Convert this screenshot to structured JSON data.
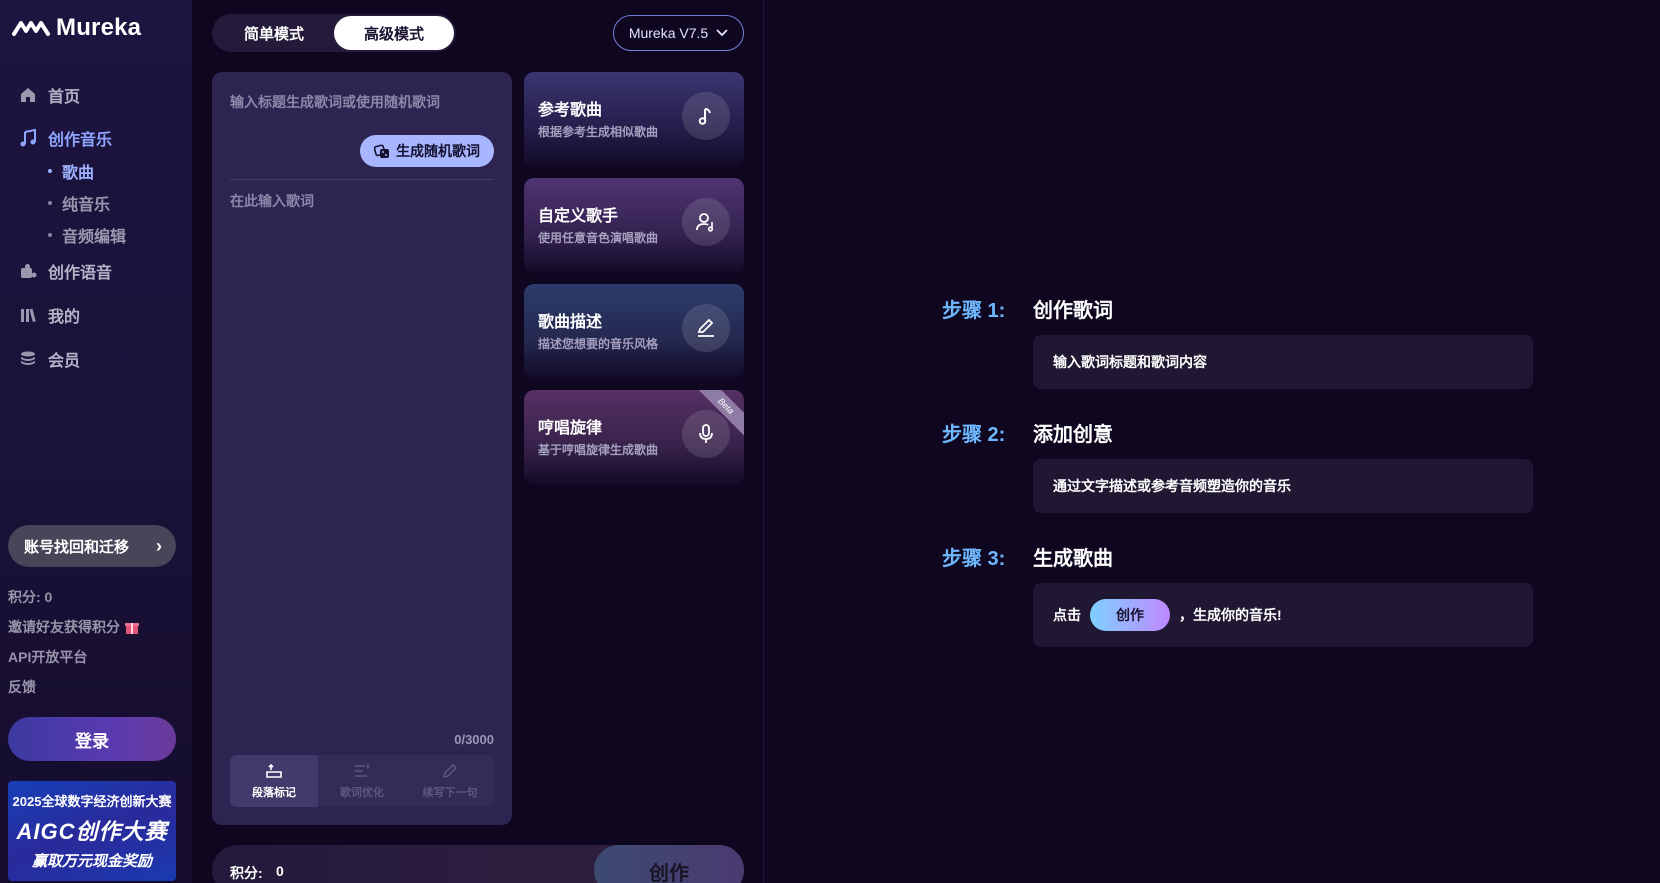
{
  "app": {
    "name": "Mureka"
  },
  "sidebar": {
    "nav": [
      {
        "label": "首页",
        "icon": "home-icon"
      },
      {
        "label": "创作音乐",
        "icon": "music-note-icon"
      },
      {
        "label": "创作语音",
        "icon": "voice-icon"
      },
      {
        "label": "我的",
        "icon": "library-icon"
      },
      {
        "label": "会员",
        "icon": "coins-icon"
      }
    ],
    "sub_items": [
      "歌曲",
      "纯音乐",
      "音频编辑"
    ],
    "account_button": "账号找回和迁移",
    "points": "积分: 0",
    "invite": "邀请好友获得积分",
    "api": "API开放平台",
    "feedback": "反馈",
    "login": "登录",
    "banner": {
      "line1": "2025全球数字经济创新大赛",
      "line2": "AIGC创作大赛",
      "line3": "赢取万元现金奖励"
    }
  },
  "modes": {
    "simple": "简单模式",
    "advanced": "高级模式",
    "active": "advanced"
  },
  "version": "Mureka V7.5",
  "lyrics": {
    "title_placeholder": "输入标题生成歌词或使用随机歌词",
    "random_button": "生成随机歌词",
    "lyrics_placeholder": "在此输入歌词",
    "counter": "0/3000",
    "tools": [
      "段落标记",
      "歌词优化",
      "续写下一句"
    ]
  },
  "cards": [
    {
      "title": "参考歌曲",
      "subtitle": "根据参考生成相似歌曲",
      "icon": "music-note-icon"
    },
    {
      "title": "自定义歌手",
      "subtitle": "使用任意音色演唱歌曲",
      "icon": "singer-icon"
    },
    {
      "title": "歌曲描述",
      "subtitle": "描述您想要的音乐风格",
      "icon": "pencil-icon"
    },
    {
      "title": "哼唱旋律",
      "subtitle": "基于哼唱旋律生成歌曲",
      "icon": "microphone-icon",
      "badge": "Beta"
    }
  ],
  "bottom": {
    "points_label": "积分:",
    "points_value": "0",
    "create": "创作"
  },
  "steps": [
    {
      "label": "步骤 1:",
      "title": "创作歌词",
      "text": "输入歌词标题和歌词内容"
    },
    {
      "label": "步骤 2:",
      "title": "添加创意",
      "text": "通过文字描述或参考音频塑造你的音乐"
    },
    {
      "label": "步骤 3:",
      "title": "生成歌曲",
      "prefix": "点击",
      "button": "创作",
      "suffix": "，生成你的音乐!"
    }
  ],
  "colors": {
    "accent": "#8fa6ff",
    "step_label": "#6fb8ff",
    "background": "#0f0620"
  }
}
